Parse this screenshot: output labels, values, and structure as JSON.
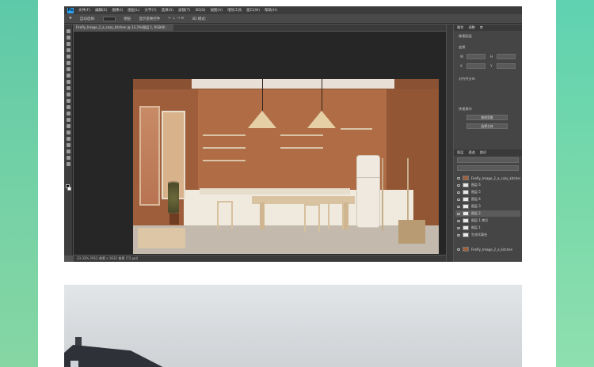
{
  "app": {
    "logo_text": "Ps",
    "menu": [
      "文件(F)",
      "编辑(E)",
      "图像(I)",
      "图层(L)",
      "文字(Y)",
      "选择(S)",
      "滤镜(T)",
      "3D(D)",
      "视图(V)",
      "增效工具",
      "窗口(W)",
      "帮助(H)"
    ],
    "options": [
      "自动选择:",
      "图层",
      "显示变换控件",
      "3D 模式:"
    ],
    "doc_tab": "Firefly_Image_2_a_cozy_kitchen @ 33.3%(图层 1, RGB/8)",
    "status": "33.33%  2912 像素 x 1632 像素 (72 ppi)"
  },
  "properties_panel": {
    "tabs": [
      "属性",
      "调整",
      "库"
    ],
    "section_pixel": "像素图层",
    "section_transform": "变换",
    "w_label": "W",
    "h_label": "H",
    "x_label": "X",
    "y_label": "Y",
    "section_align": "对齐并分布",
    "section_quick": "快速操作",
    "btn_remove_bg": "移除背景",
    "btn_select_subject": "选择主体"
  },
  "layers_panel": {
    "tabs": [
      "图层",
      "通道",
      "路径"
    ],
    "layers": [
      {
        "name": "Firefly_Image_2_a_cozy_kitchen",
        "selected": false,
        "photo": true
      },
      {
        "name": "图层 6",
        "selected": false,
        "photo": false
      },
      {
        "name": "图层 5",
        "selected": false,
        "photo": false
      },
      {
        "name": "图层 4",
        "selected": false,
        "photo": false
      },
      {
        "name": "图层 3",
        "selected": false,
        "photo": false
      },
      {
        "name": "图层 2",
        "selected": true,
        "photo": false
      },
      {
        "name": "图层 1 拷贝",
        "selected": false,
        "photo": false
      },
      {
        "name": "图层 1",
        "selected": false,
        "photo": false
      },
      {
        "name": "生成式填充",
        "selected": false,
        "photo": false
      },
      {
        "name": "Firefly_Image_2_a_kitchen",
        "selected": false,
        "photo": true
      }
    ]
  }
}
